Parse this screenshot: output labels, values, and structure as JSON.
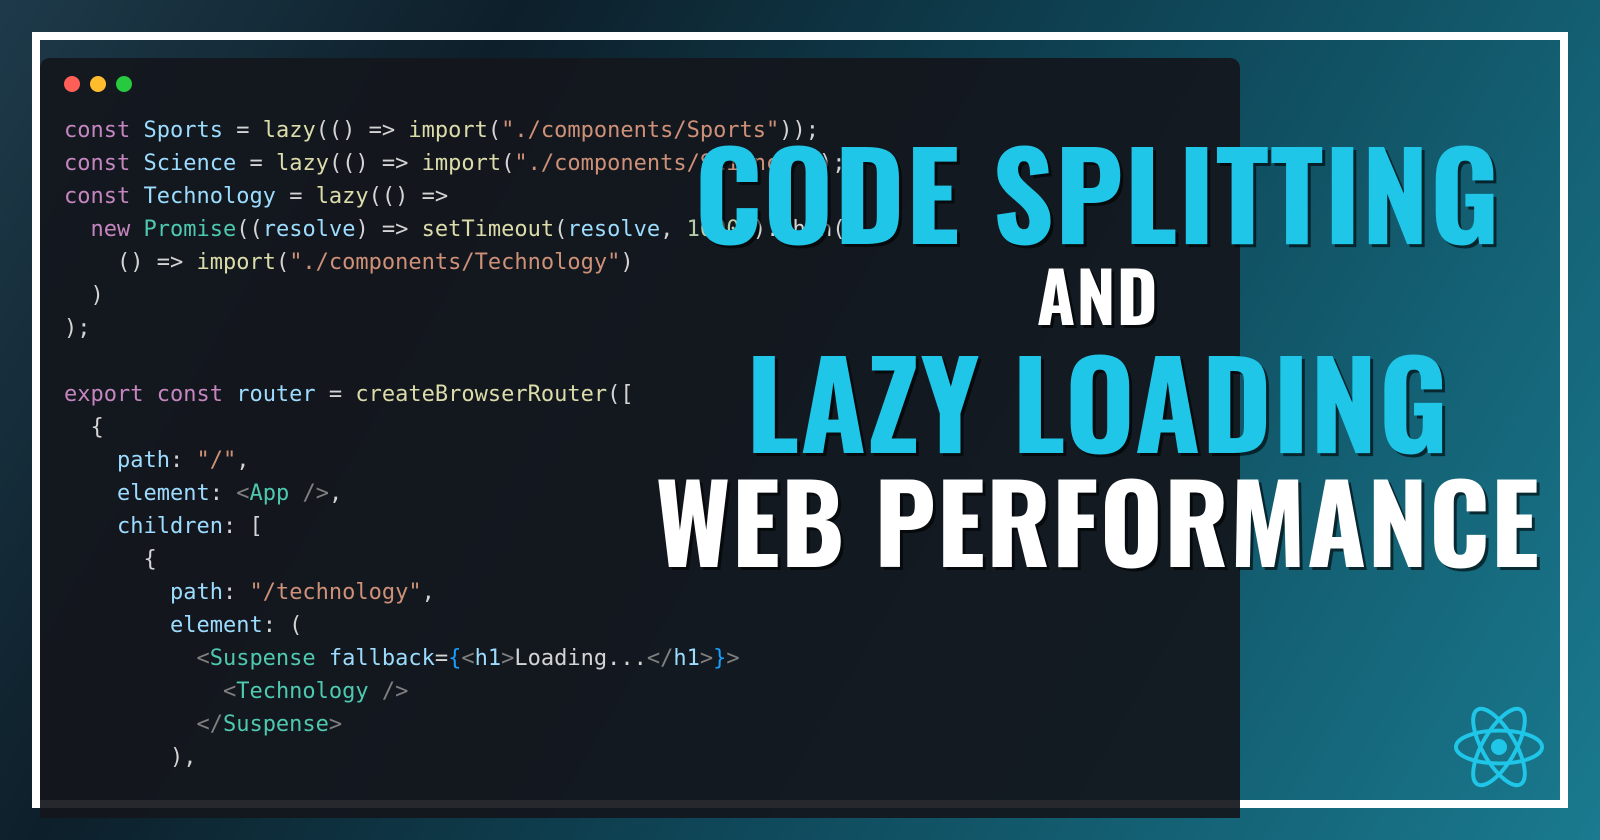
{
  "title": {
    "line1": "CODE SPLITTING",
    "line2": "AND",
    "line3": "LAZY LOADING",
    "line4": "WEB PERFORMANCE"
  },
  "colors": {
    "accent": "#1fc6e8",
    "white": "#ffffff"
  },
  "code": {
    "line1_kw": "const",
    "line1_var": " Sports ",
    "line1_eq": "= ",
    "line1_fn": "lazy",
    "line1_rest_a": "(() => ",
    "line1_fn2": "import",
    "line1_paren": "(",
    "line1_str": "\"./components/Sports\"",
    "line1_close": "));",
    "line2_kw": "const",
    "line2_var": " Science ",
    "line2_eq": "= ",
    "line2_fn": "lazy",
    "line2_rest_a": "(() => ",
    "line2_fn2": "import",
    "line2_paren": "(",
    "line2_str": "\"./components/Science\"",
    "line2_close": "));",
    "line3_kw": "const",
    "line3_var": " Technology ",
    "line3_eq": "= ",
    "line3_fn": "lazy",
    "line3_rest_a": "(() =>",
    "line4_indent": "  ",
    "line4_kw": "new",
    "line4_promise": " Promise",
    "line4_open": "((",
    "line4_res": "resolve",
    "line4_mid": ") => ",
    "line4_fn": "setTimeout",
    "line4_paren": "(",
    "line4_res2": "resolve",
    "line4_comma": ", ",
    "line4_num": "1000",
    "line4_close": ")).then(",
    "line5_indent": "    () => ",
    "line5_fn": "import",
    "line5_paren": "(",
    "line5_str": "\"./components/Technology\"",
    "line5_close": ")",
    "line6": "  )",
    "line7": ");",
    "blank": "",
    "line8_kw": "export const",
    "line8_var": " router ",
    "line8_eq": "= ",
    "line8_fn": "createBrowserRouter",
    "line8_open": "([",
    "line9": "  {",
    "line10_indent": "    ",
    "line10_prop": "path",
    "line10_colon": ": ",
    "line10_str": "\"/\"",
    "line10_comma": ",",
    "line11_indent": "    ",
    "line11_prop": "element",
    "line11_colon": ": ",
    "line11_tag_open": "<",
    "line11_comp": "App",
    "line11_tag_close": " />",
    "line11_comma": ",",
    "line12_indent": "    ",
    "line12_prop": "children",
    "line12_colon": ": [",
    "line13": "      {",
    "line14_indent": "        ",
    "line14_prop": "path",
    "line14_colon": ": ",
    "line14_str": "\"/technology\"",
    "line14_comma": ",",
    "line15_indent": "        ",
    "line15_prop": "element",
    "line15_colon": ": (",
    "line16_indent": "          ",
    "line16_tag_open": "<",
    "line16_comp": "Suspense",
    "line16_space": " ",
    "line16_attr": "fallback",
    "line16_eq": "=",
    "line16_brace": "{",
    "line16_h1o": "<",
    "line16_h1": "h1",
    "line16_h1c": ">",
    "line16_txt": "Loading...",
    "line16_h1o2": "</",
    "line16_h12": "h1",
    "line16_h1c2": ">",
    "line16_brace2": "}",
    "line16_close": ">",
    "line17_indent": "            ",
    "line17_tag_open": "<",
    "line17_comp": "Technology",
    "line17_tag_close": " />",
    "line18_indent": "          ",
    "line18_tag_open": "</",
    "line18_comp": "Suspense",
    "line18_tag_close": ">",
    "line19": "        ),",
    "line20": "        {"
  },
  "icons": {
    "window_close": "red-dot",
    "window_min": "yellow-dot",
    "window_max": "green-dot",
    "react": "react-logo"
  }
}
